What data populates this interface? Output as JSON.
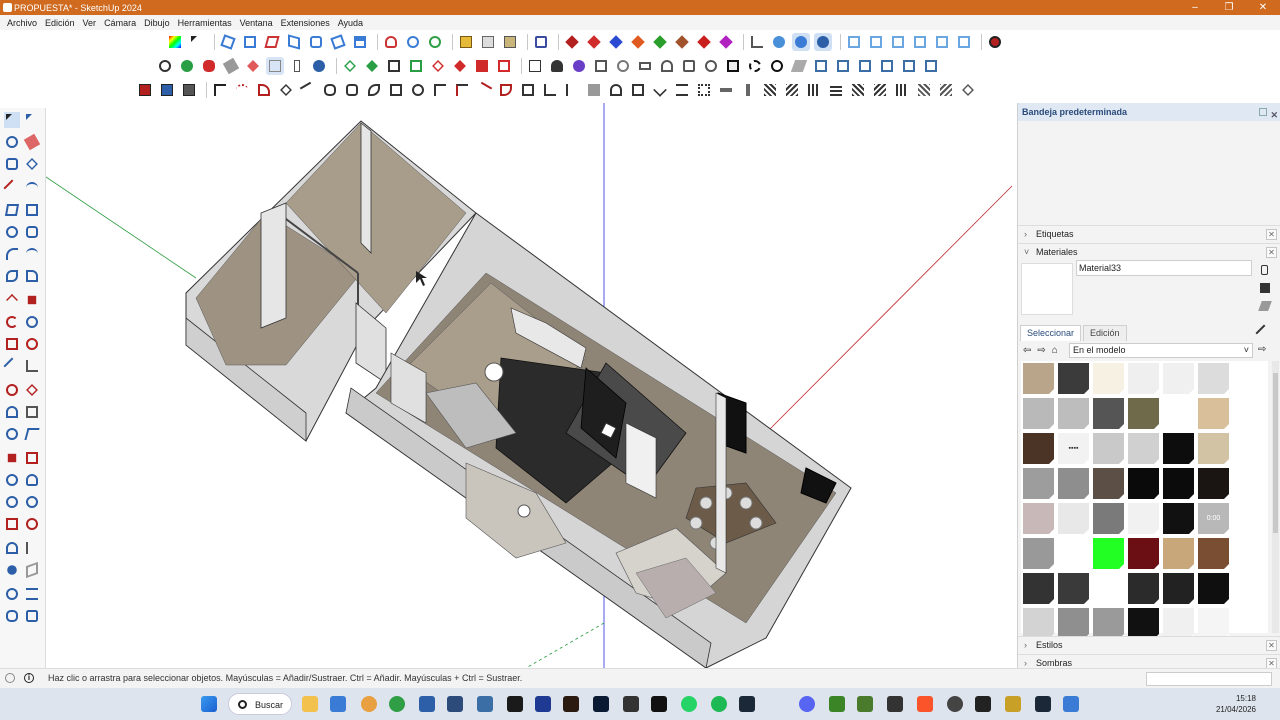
{
  "window": {
    "title": "PROPUESTA* - SketchUp 2024",
    "controls": [
      "–",
      "❐",
      "✕"
    ]
  },
  "menu": [
    "Archivo",
    "Edición",
    "Ver",
    "Cámara",
    "Dibujo",
    "Herramientas",
    "Ventana",
    "Extensiones",
    "Ayuda"
  ],
  "tray": {
    "title": "Bandeja predeterminada",
    "sections": {
      "etiquetas": "Etiquetas",
      "materiales": "Materiales",
      "estilos": "Estilos",
      "sombras": "Sombras"
    },
    "material_name": "Material33",
    "tabs": [
      "Seleccionar",
      "Edición"
    ],
    "library": "En el modelo",
    "swatch_label_dots": "▪▪▪▪",
    "swatch_label_clock": "0:00",
    "swatch_colors": [
      "#b8a58a",
      "#3b3b3b",
      "#f7f1e3",
      "#efefef",
      "#f0f0f0",
      "#dcdcdc",
      null,
      "#b9b9b9",
      "#bdbdbd",
      "#555555",
      "#6f6a4a",
      "#ffffff",
      "#d9c09a",
      null,
      "#4b3426",
      "#f2f2f2",
      "#c9c9c9",
      "#d0d0d0",
      "#0d0d0d",
      "#d3c3a5",
      null,
      "#9d9d9d",
      "#8e8e8e",
      "#5c4f45",
      "#0a0a0a",
      "#0b0b0b",
      "#1a1512",
      null,
      "#c9b8b8",
      "#e8e8e8",
      "#7a7a7a",
      "#f1f1f1",
      "#111111",
      "#b8b8b8",
      null,
      "#999999",
      "#ffffff",
      "#22ff22",
      "#6b0f14",
      "#c8a87a",
      "#7a4e33",
      null,
      "#333333",
      "#3a3a3a",
      "#ffffff",
      "#2b2b2b",
      "#222222",
      "#0f0f0f",
      null,
      "#d3d3d3",
      "#8f8f8f",
      "#9a9a9a",
      "#111111",
      "#f0f0f0",
      "#f5f5f5",
      null
    ]
  },
  "status": {
    "message": "Haz clic o arrastra para seleccionar objetos. Mayúsculas = Añadir/Sustraer. Ctrl = Añadir. Mayúsculas + Ctrl = Sustraer."
  },
  "taskbar": {
    "search_label": "Buscar",
    "time": "15:18",
    "date": "21/04/2026"
  },
  "colors": {
    "title_bar": "#cf6a1f",
    "axis_red": "#c0272d",
    "axis_green": "#2f9e44",
    "axis_blue": "#2b2be0",
    "wall": "#d9d9d9",
    "wood_floor": "#8f8577"
  }
}
